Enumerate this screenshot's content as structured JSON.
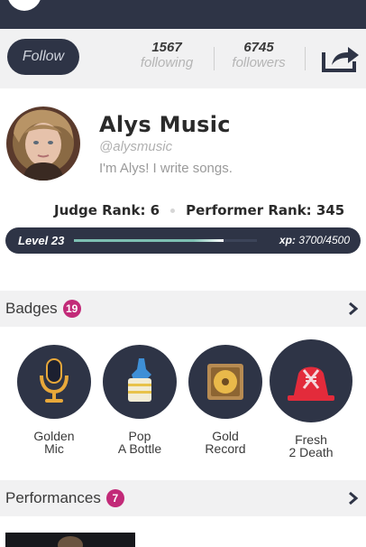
{
  "header": {
    "bg_color": "#2e3446"
  },
  "social": {
    "follow_label": "Follow",
    "following_count": "1567",
    "following_label": "following",
    "followers_count": "6745",
    "followers_label": "followers",
    "share_icon": "share-icon"
  },
  "profile": {
    "name": "Alys Music",
    "handle": "@alysmusic",
    "bio": "I'm Alys! I write songs.",
    "judge_rank_label": "Judge Rank: 6",
    "performer_rank_label": "Performer Rank: 345"
  },
  "level": {
    "label": "Level 23",
    "xp_prefix": "xp:",
    "xp_value": "3700/4500",
    "progress_fraction": 0.82,
    "progress_color": "#7dbfb2"
  },
  "badges_section": {
    "title": "Badges",
    "count": "19",
    "items": [
      {
        "label": "Golden\nMic",
        "icon": "golden-mic-icon"
      },
      {
        "label": "Pop\nA Bottle",
        "icon": "champagne-bucket-icon"
      },
      {
        "label": "Gold\nRecord",
        "icon": "gold-record-icon"
      },
      {
        "label": "Fresh\n2 Death",
        "icon": "fresh-2-death-icon"
      }
    ]
  },
  "performances_section": {
    "title": "Performances",
    "count": "7"
  },
  "colors": {
    "accent": "#c22a78",
    "dark": "#2e3446"
  }
}
